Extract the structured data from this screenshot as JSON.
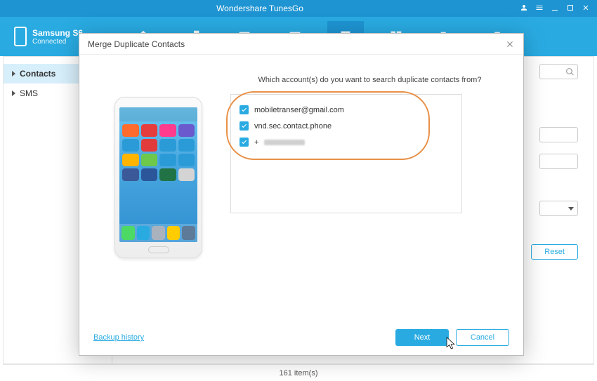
{
  "titlebar": {
    "title": "Wondershare TunesGo"
  },
  "device": {
    "name": "Samsung S6",
    "status": "Connected"
  },
  "sidebar": {
    "items": [
      {
        "label": "Contacts"
      },
      {
        "label": "SMS"
      }
    ]
  },
  "rightButtons": {
    "unknown": "",
    "reset": "Reset"
  },
  "status": {
    "count": "161 item(s)"
  },
  "modal": {
    "title": "Merge Duplicate Contacts",
    "question": "Which account(s) do you want to search duplicate contacts from?",
    "accounts": [
      {
        "label": "mobiletranser@gmail.com",
        "checked": true
      },
      {
        "label": "vnd.sec.contact.phone",
        "checked": true
      },
      {
        "label": "+",
        "checked": true,
        "blurred": true
      }
    ],
    "backupHistory": "Backup history",
    "next": "Next",
    "cancel": "Cancel"
  }
}
